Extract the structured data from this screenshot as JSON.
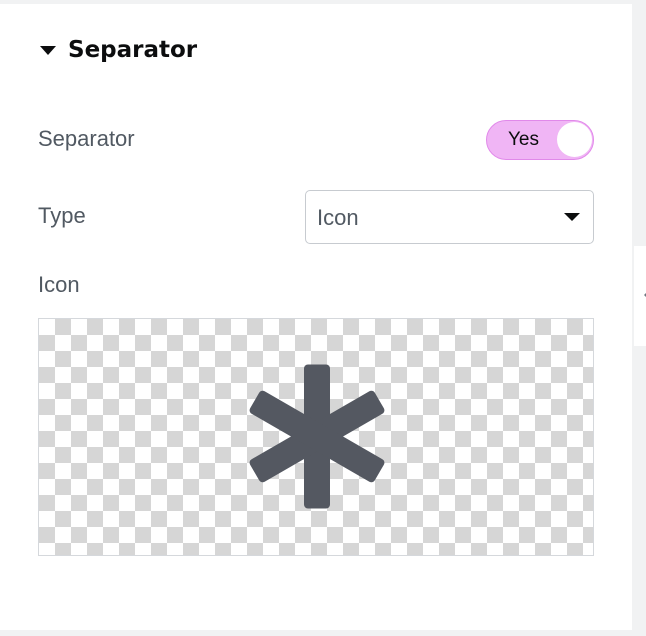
{
  "section": {
    "title": "Separator",
    "caret_icon": "caret-down-icon"
  },
  "separator_control": {
    "label": "Separator",
    "toggle_text": "Yes",
    "toggle_state": "on",
    "toggle_color": "#f0b5f5"
  },
  "type_control": {
    "label": "Type",
    "selected": "Icon"
  },
  "icon_control": {
    "label": "Icon",
    "preview_icon": "asterisk-icon",
    "icon_color": "#545861"
  }
}
